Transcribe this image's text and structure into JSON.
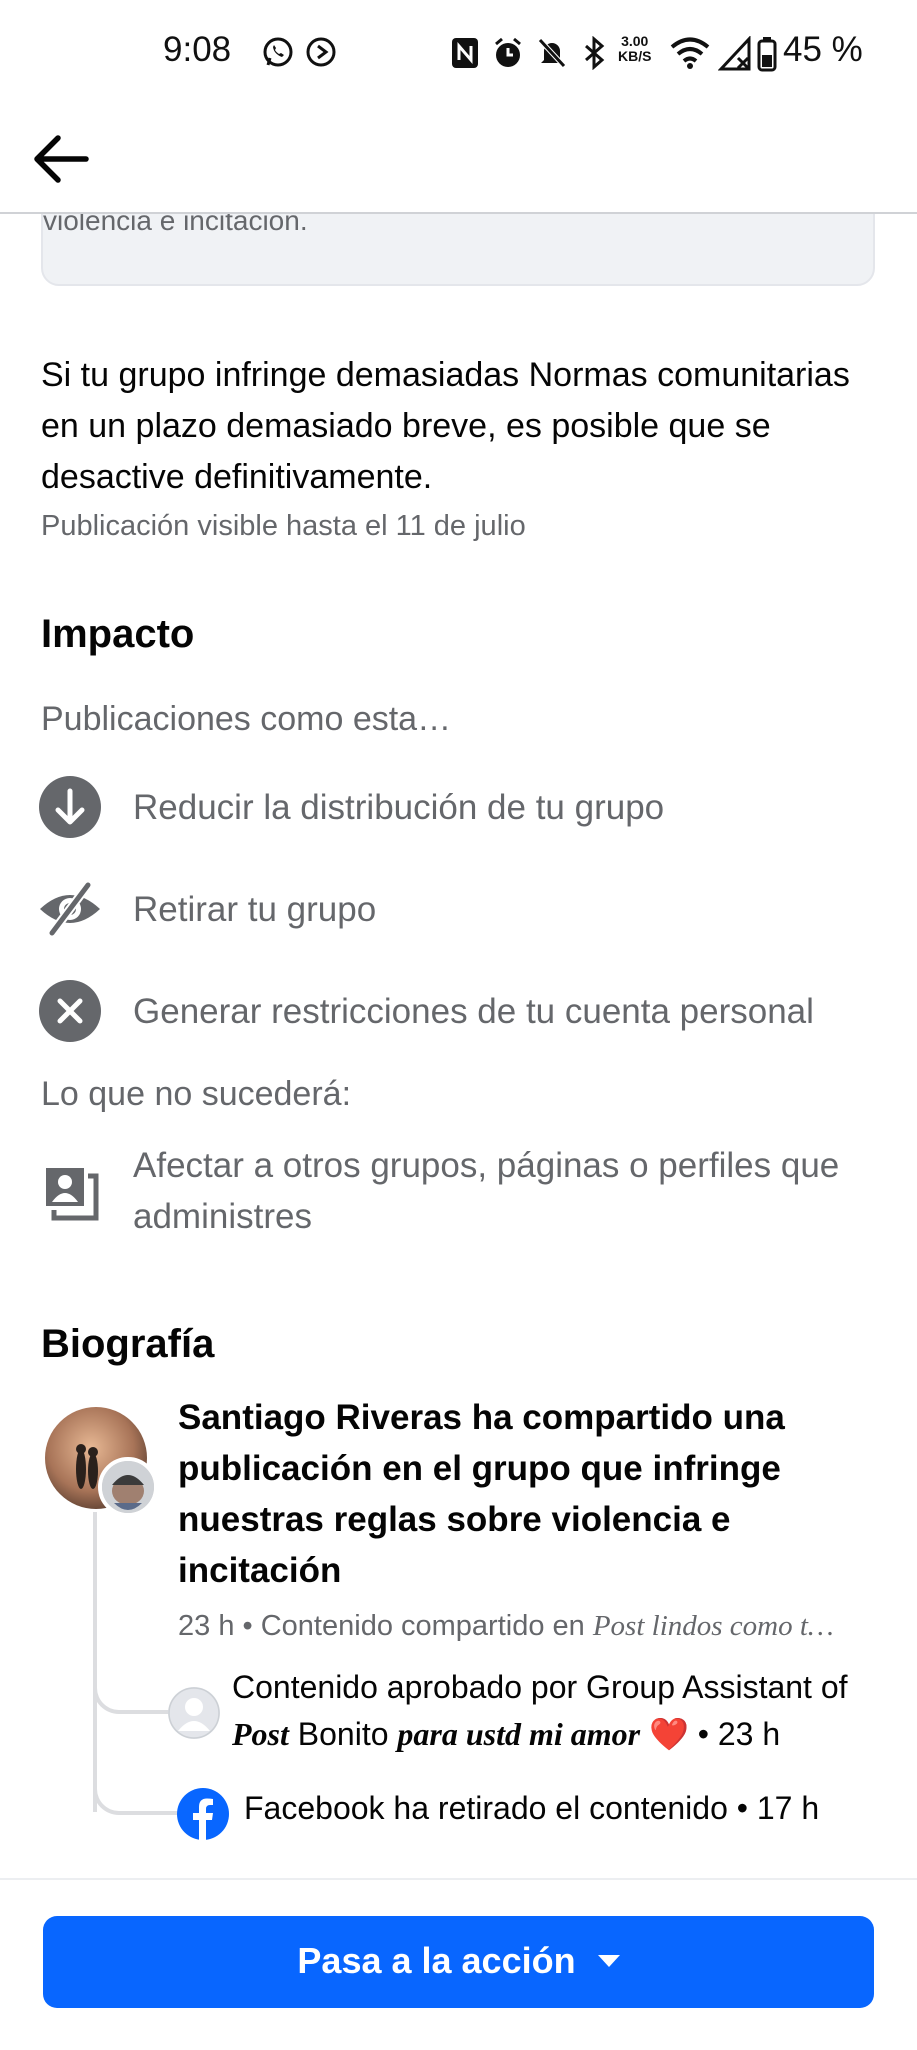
{
  "status_bar": {
    "time": "9:08",
    "net_speed_value": "3.00",
    "net_speed_unit": "KB/S",
    "battery_percent": "45 %",
    "icons": [
      "whatsapp-icon",
      "status-icon",
      "nfc-icon",
      "alarm-icon",
      "mute-icon",
      "bluetooth-icon",
      "wifi-icon",
      "signal-icon",
      "battery-icon"
    ]
  },
  "app_bar": {
    "back_icon": "arrow-left-icon"
  },
  "rule_card": {
    "text_tail": "violencia e incitación."
  },
  "warning_text": "Si tu grupo infringe demasiadas Normas comunitarias en un plazo demasiado breve, es posible que se desactive definitivamente.",
  "visible_until": "Publicación visible hasta el 11 de julio",
  "impact": {
    "heading": "Impacto",
    "subheading": "Publicaciones como esta…",
    "items": [
      {
        "icon": "arrow-down-circle-icon",
        "label": "Reducir la distribución de tu grupo"
      },
      {
        "icon": "eye-off-icon",
        "label": "Retirar tu grupo"
      },
      {
        "icon": "x-circle-icon",
        "label": "Generar restricciones de tu cuenta personal"
      }
    ],
    "wont_heading": "Lo que no sucederá:",
    "wont_items": [
      {
        "icon": "profiles-icon",
        "label": "Afectar a otros grupos, páginas o perfiles que administres"
      }
    ]
  },
  "biography": {
    "heading": "Biografía",
    "event": {
      "actor": "Santiago Riveras",
      "action": "ha compartido una publicación en el grupo que infringe nuestras reglas sobre violencia e incitación",
      "meta_time": "23 h",
      "meta_prefix": "Contenido compartido en",
      "group_name": "Post lindos como t…"
    },
    "sub_events": [
      {
        "icon": "default-avatar-icon",
        "text_prefix": "Contenido aprobado por Group Assistant of",
        "group_word1": "Post",
        "group_word2": "Bonito",
        "group_word3": "para ustd mi amor",
        "emoji": "❤️",
        "time": "• 23 h"
      },
      {
        "icon": "facebook-icon",
        "text": "Facebook ha retirado el contenido • 17 h"
      }
    ]
  },
  "action_button": {
    "label": "Pasa a la acción",
    "icon": "caret-down-icon"
  },
  "colors": {
    "primary": "#0866ff",
    "secondary_text": "#65676b",
    "card_bg": "#f0f2f5",
    "icon_gray": "#65676b"
  }
}
